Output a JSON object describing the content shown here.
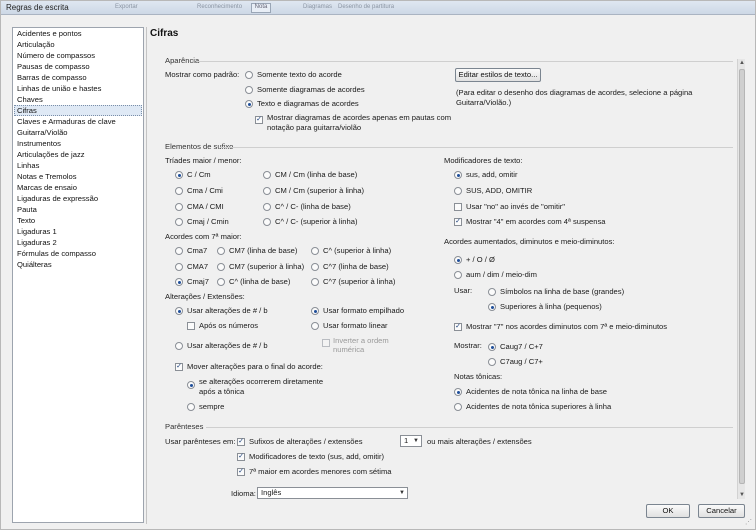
{
  "window": {
    "title": "Regras de escrita"
  },
  "ghost_toolbar": [
    "Exportar",
    "Reconhecimento",
    "Nota",
    "Diagramas",
    "Desenho de partitura"
  ],
  "sidebar": {
    "items": [
      "Acidentes e pontos",
      "Articulação",
      "Número de compassos",
      "Pausas de compasso",
      "Barras de compasso",
      "Linhas de união e hastes",
      "Chaves",
      "Cifras",
      "Claves e Armaduras de clave",
      "Guitarra/Violão",
      "Instrumentos",
      "Articulações de jazz",
      "Linhas",
      "Notas e Tremolos",
      "Marcas de ensaio",
      "Ligaduras de expressão",
      "Pauta",
      "Texto",
      "Ligaduras 1",
      "Ligaduras 2",
      "Fórmulas de compasso",
      "Quiálteras"
    ],
    "selected": "Cifras"
  },
  "heading": "Cifras",
  "appearance": {
    "title": "Aparência",
    "default_label": "Mostrar como padrão:",
    "options": [
      "Somente texto do acorde",
      "Somente diagramas de acordes",
      "Texto e diagramas de acordes"
    ],
    "guitar_check_line1": "Mostrar diagramas de acordes apenas em pautas com",
    "guitar_check_line2": "notação para guitarra/violão",
    "edit_button": "Editar estilos de texto...",
    "note_line1": "(Para editar o desenho dos diagramas de acordes, selecione a página",
    "note_line2": "Guitarra/Violão.)"
  },
  "suffix": {
    "title": "Elementos de sufixo",
    "triads_title": "Tríades maior / menor:",
    "triads": [
      [
        "C / Cm",
        "CM / Cm (linha de base)"
      ],
      [
        "Cma / Cmi",
        "CM / Cm (superior à linha)"
      ],
      [
        "CMA / CMI",
        "C^ / C- (linha de base)"
      ],
      [
        "Cmaj / Cmin",
        "C^ / C- (superior à linha)"
      ]
    ],
    "sevenths_title": "Acordes com 7ª maior:",
    "sevenths": [
      [
        "Cma7",
        "CM7 (linha de base)",
        "C^ (superior à linha)"
      ],
      [
        "CMA7",
        "CM7 (superior à linha)",
        "C^7 (linha de base)"
      ],
      [
        "Cmaj7",
        "C^ (linha de base)",
        "C^7 (superior à linha)"
      ]
    ],
    "alterations_title": "Alterações / Extensões:",
    "use_sharp_flat": "Usar alterações de # / b",
    "after_numbers": "Após os números",
    "use_sharp_flat_2": "Usar alterações de # / b",
    "stacked_format": "Usar formato empilhado",
    "linear_format": "Usar formato linear",
    "invert_line1": "Inverter a ordem",
    "invert_line2": "numérica",
    "move_end": "Mover alterações para o final do acorde:",
    "move_opt1_line1": "se alterações ocorrerem diretamente",
    "move_opt1_line2": "após a tônica",
    "move_opt2": "sempre",
    "modifiers_title": "Modificadores de texto:",
    "modifiers": [
      "sus, add, omitir",
      "SUS, ADD, OMITIR"
    ],
    "use_no": "Usar \"no\" ao invés de \"omitir\"",
    "show_4": "Mostrar \"4\" em acordes com 4ª suspensa",
    "aug_title": "Acordes aumentados, diminutos e meio-diminutos:",
    "aug_opts": [
      "+ / O / Ø",
      "aum / dim / meio-dim"
    ],
    "use_label": "Usar:",
    "use_opts": [
      "Símbolos na linha de base (grandes)",
      "Superiores à linha (pequenos)"
    ],
    "show_7": "Mostrar \"7\" nos acordes diminutos com 7ª e meio-diminutos",
    "show_label": "Mostrar:",
    "show_opts": [
      "Caug7 / C+7",
      "C7aug / C7+"
    ],
    "tonic_title": "Notas tônicas:",
    "tonic_opts": [
      "Acidentes de nota tônica na linha de base",
      "Acidentes de nota tônica superiores à linha"
    ]
  },
  "parentheses": {
    "title": "Parênteses",
    "label": "Usar parênteses em:",
    "items": [
      "Sufixos de alterações / extensões",
      "Modificadores de texto (sus, add, omitir)",
      "7ª maior em acordes menores com sétima"
    ],
    "count": "1",
    "count_suffix": "ou mais alterações / extensões"
  },
  "language": {
    "label": "Idioma:",
    "value": "Inglês"
  },
  "footer": {
    "ok": "OK",
    "cancel": "Cancelar"
  }
}
